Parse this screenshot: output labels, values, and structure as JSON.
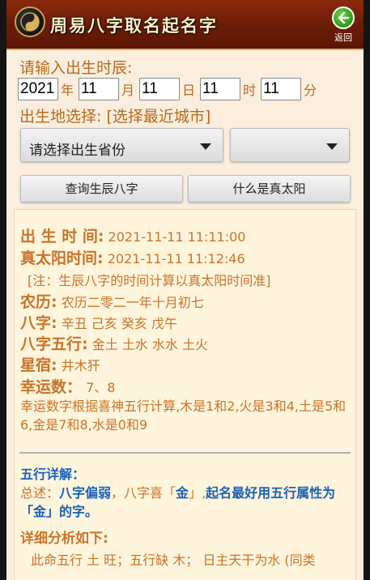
{
  "header": {
    "title": "周易八字取名起名字",
    "back_label": "返回"
  },
  "form": {
    "birth_time_label": "请输入出生时辰:",
    "year": "2021",
    "year_unit": "年",
    "month": "11",
    "month_unit": "月",
    "day": "11",
    "day_unit": "日",
    "hour": "11",
    "hour_unit": "时",
    "minute": "11",
    "minute_unit": "分",
    "birthplace_label": "出生地选择:",
    "nearest_city": "[选择最近城市]",
    "province_select": "请选择出生省份",
    "city_select": "",
    "query_button": "查询生辰八字",
    "solar_button": "什么是真太阳"
  },
  "result": {
    "birth_time_key": "出 生 时 间:",
    "birth_time_val": "2021-11-11 11:11:00",
    "true_solar_key": "真太阳时间:",
    "true_solar_val": "2021-11-11 11:12:46",
    "note": "[注：生辰八字的时间计算以真太阳时间准]",
    "lunar_key": "农历:",
    "lunar_val": "农历二零二一年十月初七",
    "bazi_key": "八字:",
    "bazi_val": "辛丑 己亥 癸亥 戊午",
    "wuxing_key": "八字五行:",
    "wuxing_val": "金土 土水 水水 土火",
    "xingxiu_key": "星宿:",
    "xingxiu_val": "井木犴",
    "lucky_key": "幸运数：",
    "lucky_val": "7、8",
    "lucky_desc": "幸运数字根据喜神五行计算,木是1和2,火是3和4,土是5和6,金是7和8,水是0和9",
    "detail_title": "五行详解：",
    "summary_prefix": "总述：",
    "summary_b1": "八字偏弱",
    "summary_mid": "，八字喜「",
    "summary_b2": "金",
    "summary_mid2": "」,",
    "summary_b3": "起名最好用五行属性为「金」的字。",
    "analysis_title": "详细分析如下:",
    "analysis_text": "此命五行 土 旺；五行缺 木；  日主天干为水 (同类"
  },
  "colors": {
    "accent": "#c8742a",
    "header_bg": "#6a1c06",
    "highlight_blue": "#1a62b8",
    "page_bg": "#fbeede"
  }
}
